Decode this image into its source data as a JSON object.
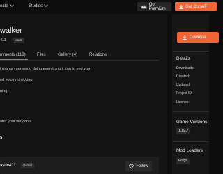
{
  "topbar": {
    "create_label": "eate",
    "studios_label": "Studios",
    "premium_label": "Go Premium",
    "get_label": "Get CurseF"
  },
  "project": {
    "title": "walker",
    "author": "411",
    "category_badge": "Mods"
  },
  "tabs": [
    {
      "label": "mments (118)"
    },
    {
      "label": "Files"
    },
    {
      "label": "Gallery (4)"
    },
    {
      "label": "Relations"
    }
  ],
  "description": {
    "lines": [
      "t roams your world doing everything it can to end you",
      "ed voice mimicking",
      "ning",
      "ator your very cool"
    ],
    "section_heading": "s"
  },
  "author_card": {
    "name": "ason411",
    "role_badge": "Owner",
    "follow_label": "Follow"
  },
  "sidebar": {
    "download_label": "Downloa",
    "details_heading": "Details",
    "details": [
      {
        "label": "Downloads:"
      },
      {
        "label": "Created:"
      },
      {
        "label": "Updated:"
      },
      {
        "label": "Project ID:"
      },
      {
        "label": "License:"
      }
    ],
    "game_versions_heading": "Game Versions",
    "game_versions": [
      "1.19.2"
    ],
    "mod_loaders_heading": "Mod Loaders",
    "mod_loaders": [
      "Forge"
    ]
  },
  "colors": {
    "accent": "#f16436",
    "background": "#0d0d0d",
    "panel": "#141414"
  }
}
